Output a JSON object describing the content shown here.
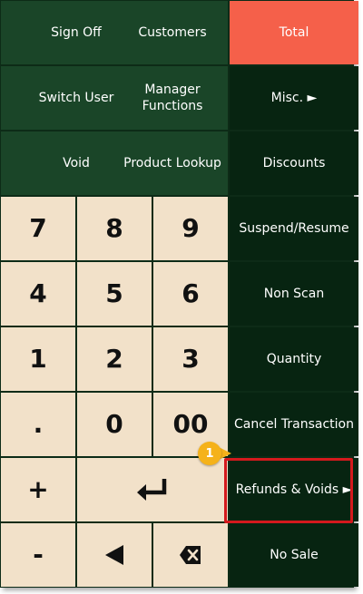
{
  "rows": {
    "r1": {
      "sign_off": "Sign Off",
      "customers": "Customers",
      "total": "Total"
    },
    "r2": {
      "switch_user": "Switch User",
      "manager_functions": "Manager Functions",
      "misc": "Misc. ►"
    },
    "r3": {
      "void": "Void",
      "product_lookup": "Product Lookup",
      "discounts": "Discounts"
    }
  },
  "keypad": {
    "k7": "7",
    "k8": "8",
    "k9": "9",
    "k4": "4",
    "k5": "5",
    "k6": "6",
    "k1": "1",
    "k2": "2",
    "k3": "3",
    "kdot": ".",
    "k0": "0",
    "k00": "00",
    "kplus": "+",
    "kminus": "-"
  },
  "side": {
    "suspend_resume": "Suspend/Resume",
    "non_scan": "Non Scan",
    "quantity": "Quantity",
    "cancel_transaction": "Cancel Transaction",
    "refunds_voids": "Refunds & Voids ►",
    "no_sale": "No Sale"
  },
  "callout": {
    "number": "1"
  },
  "icons": {
    "enter": "enter-icon",
    "back": "left-arrow-icon",
    "backspace": "backspace-icon"
  },
  "colors": {
    "panel_bg": "#0d2b17",
    "green_button": "#1a4528",
    "dark_button": "#072411",
    "total_button": "#f5604a",
    "key_bg": "#f2e1c9",
    "highlight": "#d4191d",
    "badge": "#f5b21a"
  }
}
